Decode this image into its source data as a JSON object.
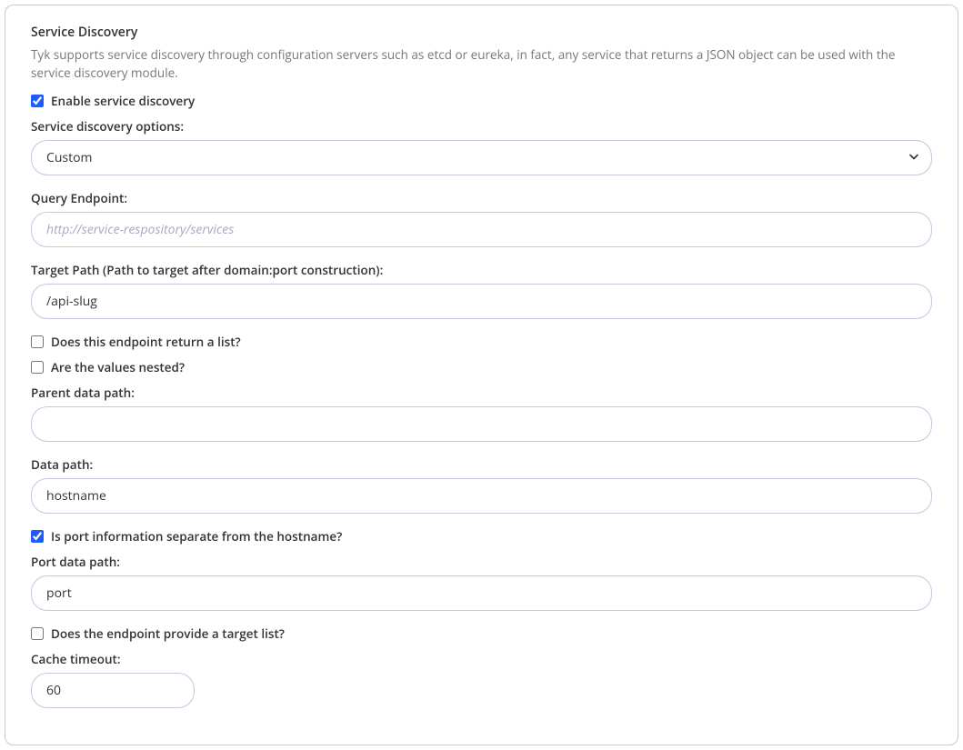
{
  "section": {
    "title": "Service Discovery",
    "description": "Tyk supports service discovery through configuration servers such as etcd or eureka, in fact, any service that returns a JSON object can be used with the service discovery module."
  },
  "enable": {
    "label": "Enable service discovery",
    "checked": true
  },
  "options": {
    "label": "Service discovery options:",
    "value": "Custom"
  },
  "query_endpoint": {
    "label": "Query Endpoint:",
    "placeholder": "http://service-respository/services",
    "value": ""
  },
  "target_path": {
    "label": "Target Path (Path to target after domain:port construction):",
    "value": "/api-slug"
  },
  "returns_list": {
    "label": "Does this endpoint return a list?",
    "checked": false
  },
  "values_nested": {
    "label": "Are the values nested?",
    "checked": false
  },
  "parent_data_path": {
    "label": "Parent data path:",
    "value": ""
  },
  "data_path": {
    "label": "Data path:",
    "value": "hostname"
  },
  "port_separate": {
    "label": "Is port information separate from the hostname?",
    "checked": true
  },
  "port_data_path": {
    "label": "Port data path:",
    "value": "port"
  },
  "target_list": {
    "label": "Does the endpoint provide a target list?",
    "checked": false
  },
  "cache_timeout": {
    "label": "Cache timeout:",
    "value": "60"
  }
}
